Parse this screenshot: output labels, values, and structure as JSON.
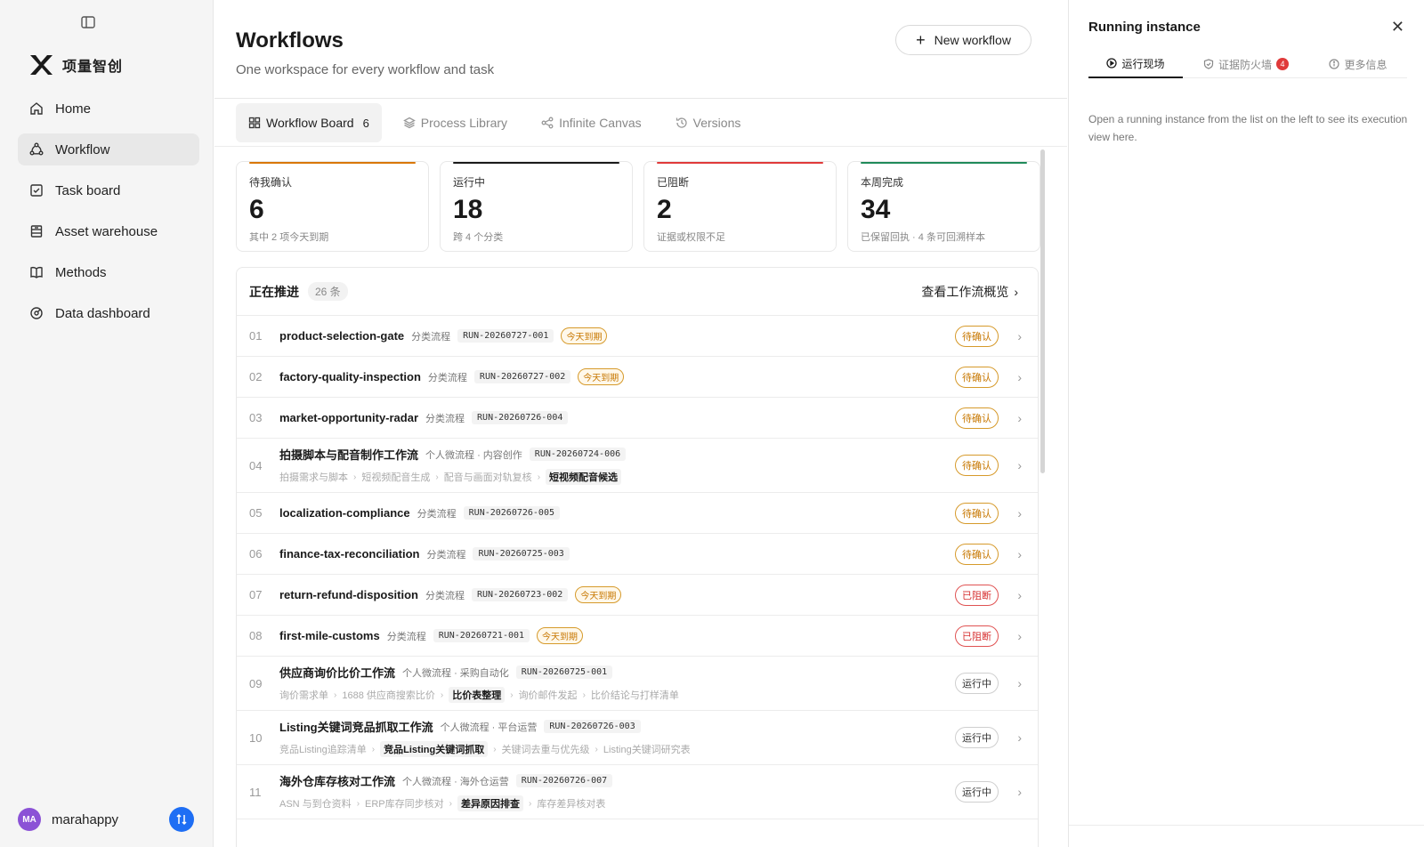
{
  "sidebar": {
    "brand": "项量智创",
    "items": [
      {
        "label": "Home",
        "icon": "home-icon"
      },
      {
        "label": "Workflow",
        "icon": "workflow-icon",
        "active": true
      },
      {
        "label": "Task board",
        "icon": "task-board-icon"
      },
      {
        "label": "Asset warehouse",
        "icon": "warehouse-icon"
      },
      {
        "label": "Methods",
        "icon": "book-icon"
      },
      {
        "label": "Data dashboard",
        "icon": "dashboard-icon"
      }
    ],
    "user": {
      "initials": "MA",
      "name": "marahappy",
      "avatar_color": "#8b52d6"
    }
  },
  "header": {
    "title": "Workflows",
    "subtitle": "One workspace for every workflow and task",
    "new_button": "New workflow"
  },
  "tabs": [
    {
      "label": "Workflow Board",
      "count": "6",
      "active": true
    },
    {
      "label": "Process Library"
    },
    {
      "label": "Infinite Canvas"
    },
    {
      "label": "Versions"
    }
  ],
  "stats": [
    {
      "label": "待我确认",
      "value": "6",
      "note": "其中 2 项今天到期",
      "color": "#d97706"
    },
    {
      "label": "运行中",
      "value": "18",
      "note": "跨 4 个分类",
      "color": "#1a1a1a"
    },
    {
      "label": "已阻断",
      "value": "2",
      "note": "证据或权限不足",
      "color": "#e03a3a"
    },
    {
      "label": "本周完成",
      "value": "34",
      "note": "已保留回执 · 4 条可回溯样本",
      "color": "#1f8a5a"
    }
  ],
  "panel": {
    "title": "正在推进",
    "count": "26 条",
    "link": "查看工作流概览"
  },
  "rows": [
    {
      "num": "01",
      "title": "product-selection-gate",
      "cat": "分类流程",
      "run": "RUN-20260727-001",
      "due": "今天到期",
      "status": "待确认",
      "status_type": "pending"
    },
    {
      "num": "02",
      "title": "factory-quality-inspection",
      "cat": "分类流程",
      "run": "RUN-20260727-002",
      "due": "今天到期",
      "status": "待确认",
      "status_type": "pending"
    },
    {
      "num": "03",
      "title": "market-opportunity-radar",
      "cat": "分类流程",
      "run": "RUN-20260726-004",
      "status": "待确认",
      "status_type": "pending"
    },
    {
      "num": "04",
      "title": "拍摄脚本与配音制作工作流",
      "cat": "个人微流程 · 内容创作",
      "run": "RUN-20260724-006",
      "steps": [
        "拍摄需求与脚本",
        "短视频配音生成",
        "配音与画面对轨复核",
        "短视频配音候选"
      ],
      "current": 3,
      "status": "待确认",
      "status_type": "pending"
    },
    {
      "num": "05",
      "title": "localization-compliance",
      "cat": "分类流程",
      "run": "RUN-20260726-005",
      "status": "待确认",
      "status_type": "pending"
    },
    {
      "num": "06",
      "title": "finance-tax-reconciliation",
      "cat": "分类流程",
      "run": "RUN-20260725-003",
      "status": "待确认",
      "status_type": "pending"
    },
    {
      "num": "07",
      "title": "return-refund-disposition",
      "cat": "分类流程",
      "run": "RUN-20260723-002",
      "due": "今天到期",
      "status": "已阻断",
      "status_type": "blocked"
    },
    {
      "num": "08",
      "title": "first-mile-customs",
      "cat": "分类流程",
      "run": "RUN-20260721-001",
      "due": "今天到期",
      "status": "已阻断",
      "status_type": "blocked"
    },
    {
      "num": "09",
      "title": "供应商询价比价工作流",
      "cat": "个人微流程 · 采购自动化",
      "run": "RUN-20260725-001",
      "steps": [
        "询价需求单",
        "1688 供应商搜索比价",
        "比价表整理",
        "询价邮件发起",
        "比价结论与打样清单"
      ],
      "current": 2,
      "status": "运行中",
      "status_type": "running"
    },
    {
      "num": "10",
      "title": "Listing关键词竞品抓取工作流",
      "cat": "个人微流程 · 平台运营",
      "run": "RUN-20260726-003",
      "steps": [
        "竞品Listing追踪清单",
        "竞品Listing关键词抓取",
        "关键词去重与优先级",
        "Listing关键词研究表"
      ],
      "current": 1,
      "status": "运行中",
      "status_type": "running"
    },
    {
      "num": "11",
      "title": "海外仓库存核对工作流",
      "cat": "个人微流程 · 海外仓运营",
      "run": "RUN-20260726-007",
      "steps": [
        "ASN 与到仓资料",
        "ERP库存同步核对",
        "差异原因排查",
        "库存差异核对表"
      ],
      "current": 2,
      "status": "运行中",
      "status_type": "running"
    }
  ],
  "right_panel": {
    "title": "Running instance",
    "tabs": [
      {
        "label": "运行现场",
        "active": true
      },
      {
        "label": "证据防火墙",
        "badge": "4"
      },
      {
        "label": "更多信息"
      }
    ],
    "message": "Open a running instance from the list on the left to see its execution view here."
  }
}
